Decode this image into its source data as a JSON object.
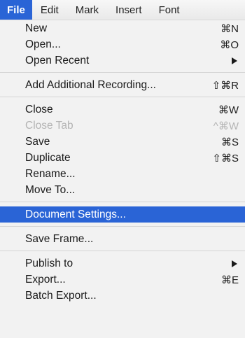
{
  "menubar": {
    "items": [
      "File",
      "Edit",
      "Mark",
      "Insert",
      "Font"
    ],
    "active_index": 0
  },
  "menu": {
    "groups": [
      [
        {
          "label": "New",
          "shortcut": "⌘N"
        },
        {
          "label": "Open...",
          "shortcut": "⌘O"
        },
        {
          "label": "Open Recent",
          "submenu": true
        }
      ],
      [
        {
          "label": "Add Additional Recording...",
          "shortcut": "⇧⌘R"
        }
      ],
      [
        {
          "label": "Close",
          "shortcut": "⌘W"
        },
        {
          "label": "Close Tab",
          "shortcut": "^⌘W",
          "disabled": true
        },
        {
          "label": "Save",
          "shortcut": "⌘S"
        },
        {
          "label": "Duplicate",
          "shortcut": "⇧⌘S"
        },
        {
          "label": "Rename..."
        },
        {
          "label": "Move To..."
        }
      ],
      [
        {
          "label": "Document Settings...",
          "highlighted": true
        }
      ],
      [
        {
          "label": "Save Frame..."
        }
      ],
      [
        {
          "label": "Publish to",
          "submenu": true
        },
        {
          "label": "Export...",
          "shortcut": "⌘E"
        },
        {
          "label": "Batch Export..."
        }
      ]
    ]
  },
  "icons": {
    "submenu": "chevron-right-icon"
  },
  "colors": {
    "highlight": "#2a64d6",
    "disabled_text": "#b4b4b4",
    "menu_background": "#f2f2f2"
  }
}
